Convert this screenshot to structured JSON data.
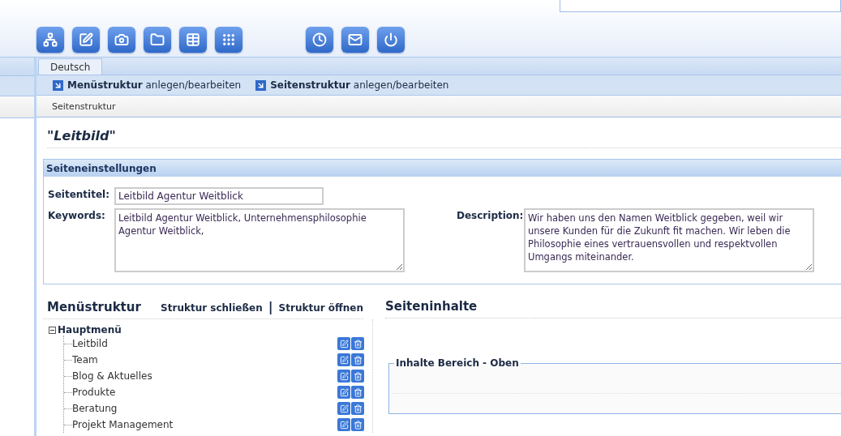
{
  "toolbar": {
    "left": [
      {
        "kind": "tree"
      },
      {
        "kind": "edit"
      },
      {
        "kind": "camera"
      },
      {
        "kind": "folder"
      },
      {
        "kind": "table"
      },
      {
        "kind": "grid"
      }
    ],
    "right": [
      {
        "kind": "clock"
      },
      {
        "kind": "mail"
      },
      {
        "kind": "power"
      }
    ]
  },
  "tabs": [
    {
      "label": "Deutsch",
      "selected": true
    }
  ],
  "links": [
    "**Menüstruktur** anlegen/bearbeiten",
    "**Seitenstruktur** anlegen/bearbeiten"
  ],
  "breadcrumb": "Seitenstruktur",
  "page_title": "\"Leitbild\"",
  "settings": {
    "title": "Seiteneinstellungen",
    "page_title_label": "Seitentitel:",
    "page_title_value": "Leitbild Agentur Weitblick",
    "keywords_label": "Keywords:",
    "keywords_value": "Leitbild Agentur Weitblick, Unternehmensphilosophie Agentur Weitblick,",
    "description_label": "Description:",
    "description_value": "Wir haben uns den Namen Weitblick gegeben, weil wir unsere Kunden für die Zukunft fit machen. Wir leben die Philosophie eines vertrauensvollen und respektvollen Umgangs miteinander."
  },
  "menu": {
    "title": "Menüstruktur",
    "close_link": "Struktur schließen",
    "separator": "|",
    "open_link": "Struktur öffnen",
    "root": {
      "label": "Hauptmenü",
      "expanded": true,
      "children": [
        {
          "label": "Leitbild"
        },
        {
          "label": "Team"
        },
        {
          "label": "Blog & Aktuelles"
        },
        {
          "label": "Produkte"
        },
        {
          "label": "Beratung"
        },
        {
          "label": "Projekt Management"
        }
      ]
    }
  },
  "content": {
    "title": "Seiteninhalte",
    "section_title": "Inhalte Bereich - Oben"
  }
}
